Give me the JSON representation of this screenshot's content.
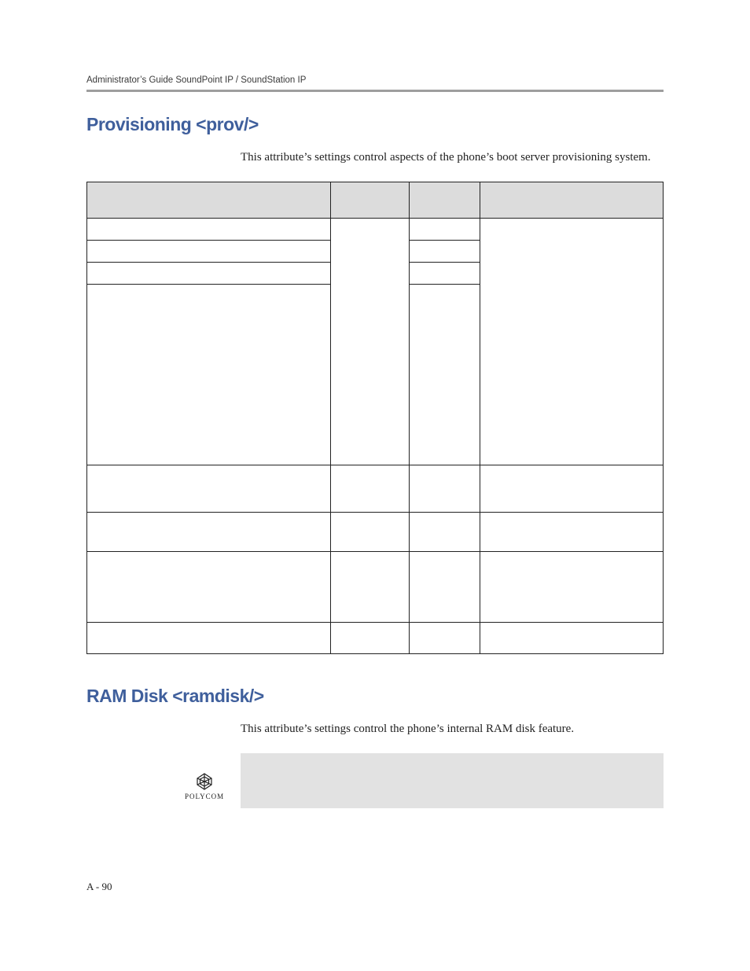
{
  "header": "Administrator’s Guide SoundPoint IP / SoundStation IP",
  "sections": {
    "provisioning": {
      "title": "Provisioning <prov/>",
      "intro": "This attribute’s settings control aspects of the phone’s boot server provisioning system."
    },
    "ramdisk": {
      "title": "RAM Disk <ramdisk/>",
      "intro": "This attribute’s settings control the phone’s internal RAM disk feature."
    }
  },
  "logo_label": "POLYCOM",
  "page_number": "A - 90"
}
